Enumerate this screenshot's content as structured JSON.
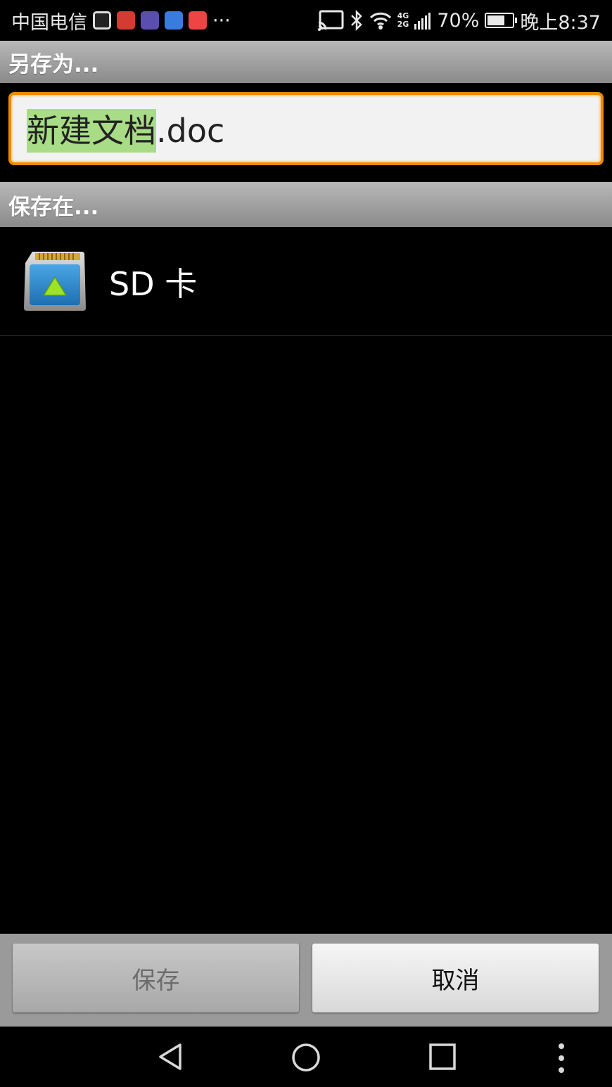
{
  "status_bar": {
    "carrier": "中国电信",
    "battery_percent_text": "70%",
    "battery_level": 0.7,
    "time": "晚上8:37",
    "more_notifications": "···",
    "network_label_top": "4G",
    "network_label_bottom": "2G"
  },
  "dialog": {
    "save_as_title": "另存为...",
    "filename_selected": "新建文档",
    "filename_extension": ".doc",
    "save_in_title": "保存在...",
    "locations": [
      {
        "label": "SD 卡",
        "icon": "sd-card-icon"
      }
    ],
    "save_button": "保存",
    "cancel_button": "取消"
  },
  "colors": {
    "input_border": "#f08a00",
    "selection_highlight": "#a9dc86",
    "header_gradient_top": "#b8b8b8",
    "header_gradient_bottom": "#8a8a8a"
  },
  "navigation": {
    "icons": [
      "back-icon",
      "home-icon",
      "recents-icon",
      "menu-icon"
    ]
  }
}
